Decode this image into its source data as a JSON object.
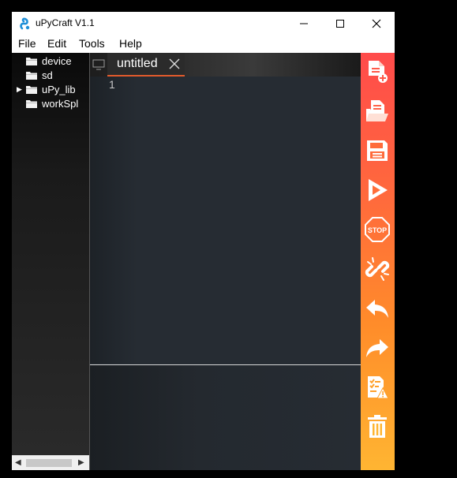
{
  "window": {
    "title": "uPyCraft V1.1",
    "controls": {
      "minimize": "—",
      "maximize": "☐",
      "close": "✕"
    }
  },
  "menu": [
    "File",
    "Edit",
    "Tools",
    "Help"
  ],
  "file_tree": [
    {
      "label": "device",
      "expandable": false
    },
    {
      "label": "sd",
      "expandable": false
    },
    {
      "label": "uPy_lib",
      "expandable": true
    },
    {
      "label": "workSpl",
      "expandable": false
    }
  ],
  "editor": {
    "tab_label": "untitled",
    "line_numbers": [
      "1"
    ]
  },
  "toolbar": [
    {
      "icon": "new-file-icon"
    },
    {
      "icon": "open-folder-icon"
    },
    {
      "icon": "save-icon"
    },
    {
      "icon": "run-icon"
    },
    {
      "icon": "stop-icon",
      "text": "STOP"
    },
    {
      "icon": "connect-link-icon"
    },
    {
      "icon": "undo-icon"
    },
    {
      "icon": "redo-icon"
    },
    {
      "icon": "syntax-check-icon"
    },
    {
      "icon": "trash-icon"
    }
  ],
  "colors": {
    "tab_accent": "#e35b2c",
    "toolbar_top": "#ff4b4b",
    "toolbar_bottom": "#ffb532",
    "editor_bg": "#262c33"
  }
}
